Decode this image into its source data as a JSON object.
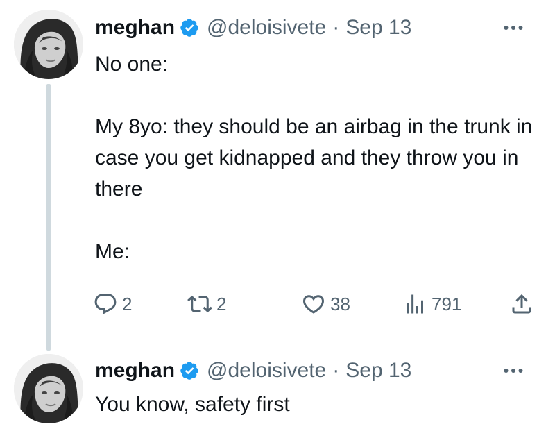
{
  "tweets": [
    {
      "author": {
        "name": "meghan",
        "handle": "@deloisivete",
        "verified": true
      },
      "separator": "·",
      "date": "Sep 13",
      "text": "No one:\n\nMy 8yo: they should be an airbag in the trunk in case you get kidnapped and they throw you in there\n\nMe:",
      "metrics": {
        "replies": "2",
        "retweets": "2",
        "likes": "38",
        "views": "791"
      }
    },
    {
      "author": {
        "name": "meghan",
        "handle": "@deloisivete",
        "verified": true
      },
      "separator": "·",
      "date": "Sep 13",
      "text": "You know, safety first"
    }
  ],
  "colors": {
    "text": "#0f1419",
    "secondary": "#536471",
    "verified": "#1d9bf0",
    "thread_line": "#cfd9de"
  },
  "icons": {
    "verified": "verified-badge-icon",
    "more": "more-options-icon",
    "reply": "reply-icon",
    "retweet": "retweet-icon",
    "like": "heart-icon",
    "views": "views-icon",
    "share": "share-icon"
  }
}
